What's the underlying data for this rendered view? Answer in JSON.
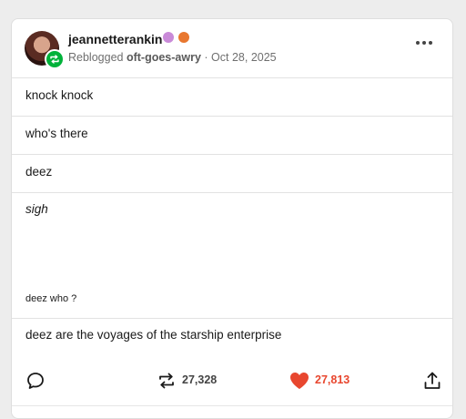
{
  "post": {
    "author": {
      "username": "jeannetterankin",
      "badges": [
        "purple-badge",
        "orange-badge"
      ]
    },
    "reblog_prefix": "Reblogged",
    "reblogged_from": "oft-goes-awry",
    "separator": "·",
    "date": "Oct 28, 2025",
    "blocks": [
      {
        "text": "knock knock"
      },
      {
        "text": "who's there"
      },
      {
        "text": "deez"
      },
      {
        "text": "sigh",
        "italic": true,
        "subtext": "deez who ?"
      },
      {
        "text": "deez are the voyages of the starship enterprise"
      }
    ],
    "actions": {
      "reblog_count": "27,328",
      "like_count": "27,813"
    }
  },
  "colors": {
    "like_red": "#e8472f",
    "reblog_green": "#00b23a",
    "muted_text": "#6f6f6f"
  }
}
